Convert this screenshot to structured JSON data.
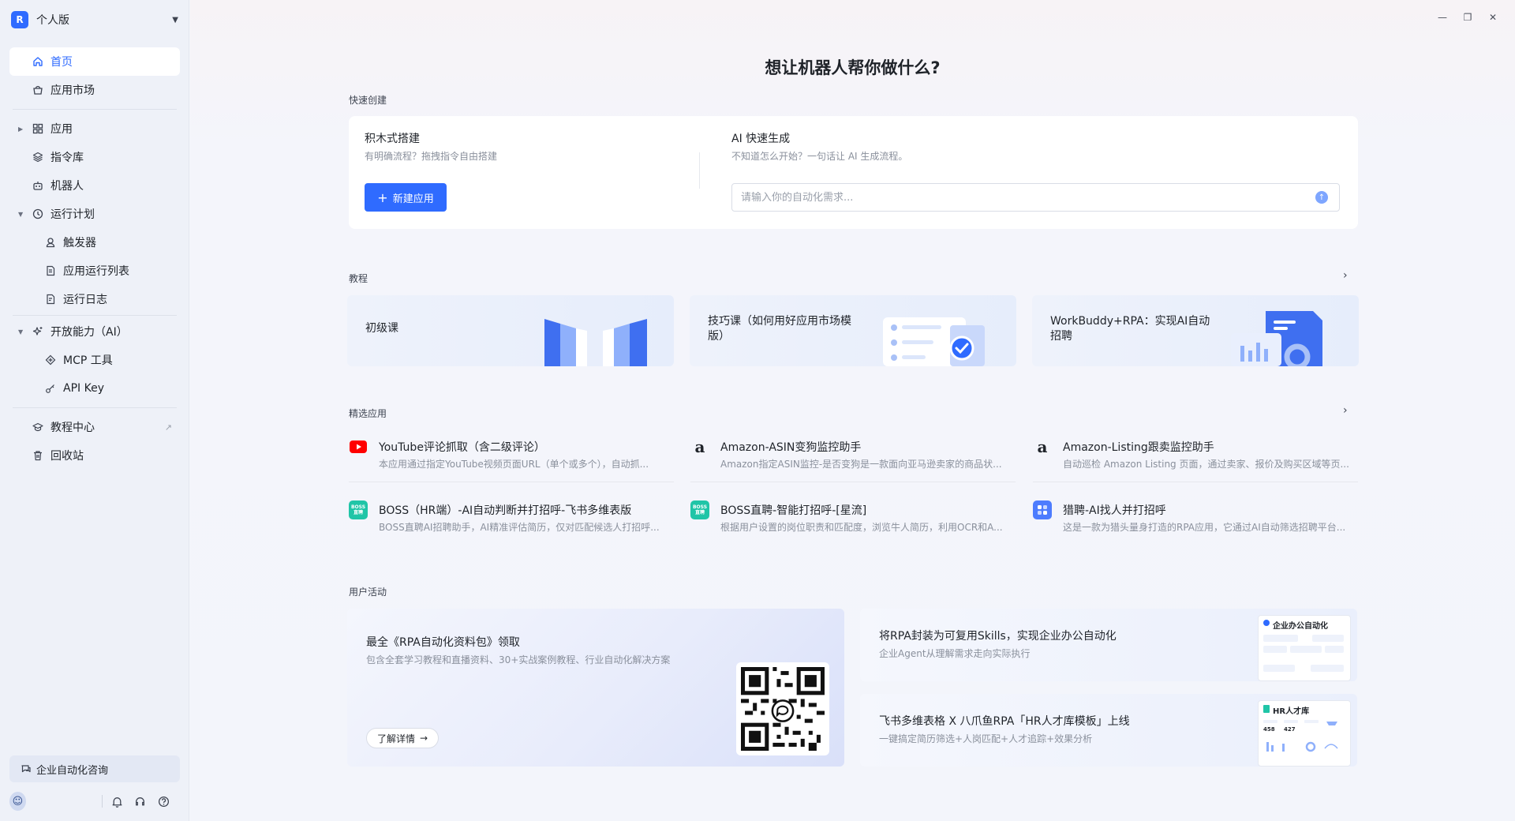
{
  "workspace": {
    "logo_glyph": "R",
    "name": "个人版"
  },
  "sidebar": {
    "items": [
      {
        "label": "首页",
        "icon": "home-icon"
      },
      {
        "label": "应用市场",
        "icon": "market-icon"
      },
      {
        "label": "应用",
        "icon": "apps-grid-icon"
      },
      {
        "label": "指令库",
        "icon": "layers-icon"
      },
      {
        "label": "机器人",
        "icon": "robot-icon"
      },
      {
        "label": "运行计划",
        "icon": "clock-icon"
      },
      {
        "label": "触发器",
        "icon": "trigger-icon"
      },
      {
        "label": "应用运行列表",
        "icon": "run-list-icon"
      },
      {
        "label": "运行日志",
        "icon": "log-icon"
      },
      {
        "label": "开放能力（AI）",
        "icon": "sparkle-icon"
      },
      {
        "label": "MCP 工具",
        "icon": "mcp-icon"
      },
      {
        "label": "API Key",
        "icon": "key-icon"
      },
      {
        "label": "教程中心",
        "icon": "graduation-icon"
      },
      {
        "label": "回收站",
        "icon": "trash-icon"
      }
    ],
    "consult_label": "企业自动化咨询"
  },
  "main": {
    "hero_title": "想让机器人帮你做什么?",
    "quick_create": {
      "section_title": "快速创建",
      "block_title": "积木式搭建",
      "block_sub": "有明确流程？拖拽指令自由搭建",
      "new_app_label": "新建应用",
      "ai_title": "AI 快速生成",
      "ai_sub": "不知道怎么开始？一句话让 AI 生成流程。",
      "ai_placeholder": "请输入你的自动化需求..."
    },
    "tutorials": {
      "section_title": "教程",
      "cards": [
        {
          "title": "初级课"
        },
        {
          "title": "技巧课（如何用好应用市场模版）"
        },
        {
          "title": "WorkBuddy+RPA：实现AI自动招聘"
        }
      ]
    },
    "featured": {
      "section_title": "精选应用",
      "apps": [
        {
          "name": "YouTube评论抓取（含二级评论）",
          "desc": "本应用通过指定YouTube视频页面URL（单个或多个），自动抓...",
          "icon": "youtube-icon",
          "glyph": "▶",
          "icon_color": "#ff0000"
        },
        {
          "name": "Amazon-ASIN变狗监控助手",
          "desc": "Amazon指定ASIN监控-是否变狗是一款面向亚马逊卖家的商品状...",
          "icon": "amazon-icon",
          "glyph": "a",
          "icon_color": "#1f2329"
        },
        {
          "name": "Amazon-Listing跟卖监控助手",
          "desc": "自动巡检 Amazon Listing 页面，通过卖家、报价及购买区域等页...",
          "icon": "amazon-icon",
          "glyph": "a",
          "icon_color": "#1f2329"
        },
        {
          "name": "BOSS（HR端）-AI自动判断并打招呼-飞书多维表版",
          "desc": "BOSS直聘AI招聘助手，AI精准评估简历，仅对匹配候选人打招呼...",
          "icon": "boss-icon",
          "glyph": "BOSS直聘",
          "icon_color": "#20c5a7"
        },
        {
          "name": "BOSS直聘-智能打招呼-[星流]",
          "desc": "根据用户设置的岗位职责和匹配度，浏览牛人简历，利用OCR和A...",
          "icon": "boss-icon",
          "glyph": "BOSS直聘",
          "icon_color": "#20c5a7"
        },
        {
          "name": "猎聘-AI找人并打招呼",
          "desc": "这是一款为猎头量身打造的RPA应用，它通过AI自动筛选招聘平台...",
          "icon": "liepin-icon",
          "glyph": "⁘",
          "icon_color": "#4d7cfe"
        }
      ]
    },
    "activities": {
      "section_title": "用户活动",
      "big": {
        "title": "最全《RPA自动化资料包》领取",
        "sub": "包含全套学习教程和直播资料、30+实战案例教程、行业自动化解决方案",
        "button": "了解详情"
      },
      "small": [
        {
          "title": "将RPA封装为可复用Skills，实现企业办公自动化",
          "sub": "企业Agent从理解需求走向实际执行",
          "thumb_title": "企业办公自动化"
        },
        {
          "title": "飞书多维表格 X 八爪鱼RPA「HR人才库模板」上线",
          "sub": "一键搞定简历筛选+人岗匹配+人才追踪+效果分析",
          "thumb_title": "HR人才库",
          "thumb_values": [
            "458",
            "427"
          ]
        }
      ]
    }
  }
}
